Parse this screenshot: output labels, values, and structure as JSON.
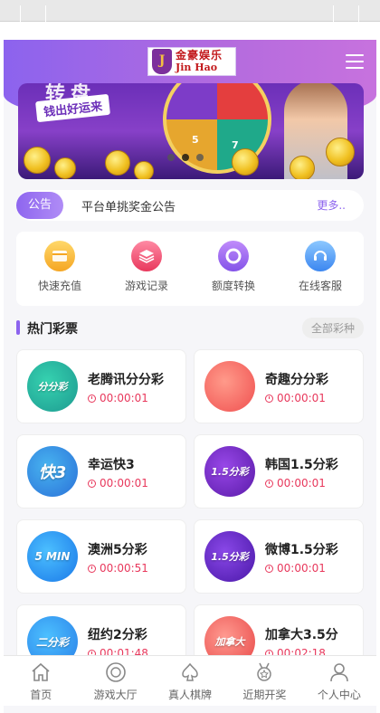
{
  "header": {
    "logo_cn": "金豪娱乐",
    "logo_en": "Jin Hao",
    "logo_mark": "J"
  },
  "banner": {
    "slogan": "钱出好运来",
    "headline": "转盘",
    "wheel_numbers": [
      "5",
      "7"
    ]
  },
  "notice": {
    "tag": "公告",
    "text": "平台单挑奖金公告",
    "more": "更多.."
  },
  "actions": [
    {
      "label": "快速充值",
      "icon": "wallet-icon"
    },
    {
      "label": "游戏记录",
      "icon": "layers-icon"
    },
    {
      "label": "额度转换",
      "icon": "exchange-icon"
    },
    {
      "label": "在线客服",
      "icon": "headset-icon"
    }
  ],
  "section": {
    "title": "热门彩票",
    "all_label": "全部彩种"
  },
  "lotteries": [
    {
      "name": "老腾讯分分彩",
      "time": "00:00:01",
      "icon_text": "分分彩"
    },
    {
      "name": "奇趣分分彩",
      "time": "00:00:01",
      "icon_text": ""
    },
    {
      "name": "幸运快3",
      "time": "00:00:01",
      "icon_text": "快3"
    },
    {
      "name": "韩国1.5分彩",
      "time": "00:00:01",
      "icon_text": "1.5分彩"
    },
    {
      "name": "澳洲5分彩",
      "time": "00:00:51",
      "icon_text": "5 MIN"
    },
    {
      "name": "微博1.5分彩",
      "time": "00:00:01",
      "icon_text": "1.5分彩"
    },
    {
      "name": "纽约2分彩",
      "time": "00:01:48",
      "icon_text": "二分彩"
    },
    {
      "name": "加拿大3.5分",
      "time": "00:02:18",
      "icon_text": "加拿大"
    }
  ],
  "tabs": [
    {
      "label": "首页",
      "icon": "home-icon"
    },
    {
      "label": "游戏大厅",
      "icon": "chip-icon"
    },
    {
      "label": "真人棋牌",
      "icon": "spade-icon"
    },
    {
      "label": "近期开奖",
      "icon": "medal-icon"
    },
    {
      "label": "个人中心",
      "icon": "user-icon"
    }
  ],
  "colors": {
    "accent": "#8c63ee",
    "countdown": "#e8385c"
  }
}
